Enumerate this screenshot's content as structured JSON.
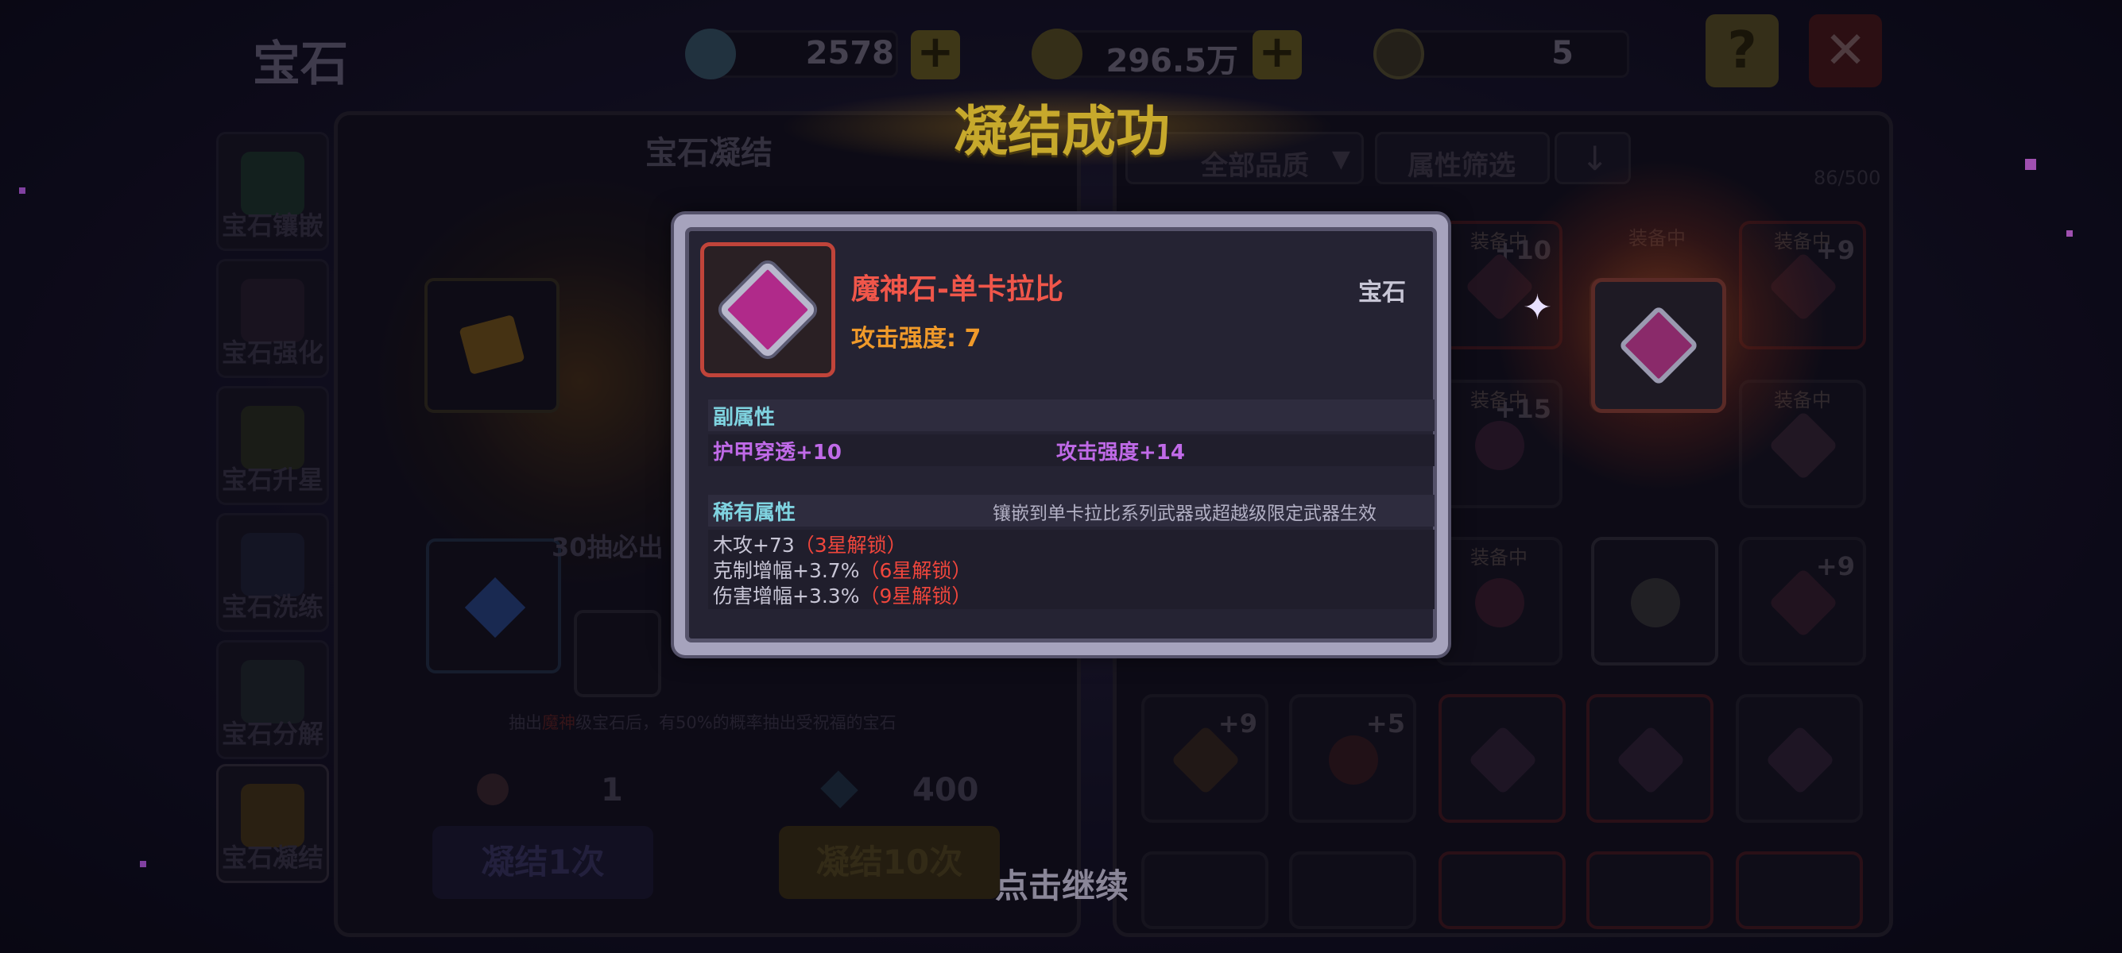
{
  "header": {
    "title": "宝石",
    "resources": [
      {
        "icon": "diamond-icon",
        "value": "2578"
      },
      {
        "icon": "gold-coin-icon",
        "value": "296.5万"
      },
      {
        "icon": "gem-token-icon",
        "value": "5"
      }
    ],
    "help_label": "?",
    "close_label": "✕"
  },
  "sidebar": {
    "items": [
      {
        "label": "宝石镶嵌",
        "icon": "gem-inlay-icon"
      },
      {
        "label": "宝石强化",
        "icon": "gem-enhance-icon"
      },
      {
        "label": "宝石升星",
        "icon": "gem-star-icon"
      },
      {
        "label": "宝石洗练",
        "icon": "gem-refine-icon"
      },
      {
        "label": "宝石分解",
        "icon": "gem-decompose-icon"
      },
      {
        "label": "宝石凝结",
        "icon": "gem-condense-icon"
      }
    ]
  },
  "condense_panel": {
    "title": "宝石凝结",
    "pity_text": "30抽必出",
    "hint_prefix": "抽出",
    "hint_highlight": "魔神",
    "hint_suffix": "级宝石后，有50%的概率抽出受祝福的宝石",
    "single": {
      "cost": "1",
      "button": "凝结1次"
    },
    "ten": {
      "cost": "400",
      "button": "凝结10次"
    }
  },
  "inventory_panel": {
    "quality_filter": "全部品质",
    "attr_filter": "属性筛选",
    "sort_icon": "arrow-down-icon",
    "count": "86/500",
    "equipped_tag": "装备中",
    "row1_pluses": [
      "+10",
      "",
      "+9"
    ],
    "row2_pluses": [
      "+15",
      "",
      ""
    ],
    "row3_pluses": [
      "",
      "",
      "+9"
    ],
    "row4_pluses": [
      "+9",
      "+5",
      "",
      "",
      ""
    ]
  },
  "banner": {
    "text": "凝结成功"
  },
  "popup": {
    "gem_name": "魔神石-单卡拉比",
    "category": "宝石",
    "attack_label": "攻击强度: 7",
    "sub_attr_title": "副属性",
    "sub_attrs": [
      "护甲穿透+10",
      "攻击强度+14"
    ],
    "rare_attr_title": "稀有属性",
    "rare_note": "镶嵌到单卡拉比系列武器或超越级限定武器生效",
    "rare_attrs": [
      {
        "text": "木攻+73",
        "lock": "（3星解锁）"
      },
      {
        "text": "克制增幅+3.7%",
        "lock": "（6星解锁）"
      },
      {
        "text": "伤害增幅+3.3%",
        "lock": "（9星解锁）"
      }
    ]
  },
  "continue_text": "点击继续",
  "colors": {
    "name_red": "#f0564a",
    "attack_orange": "#f09a2a",
    "title_cyan": "#7fd3e0",
    "sub_purple": "#c06ae8",
    "lock_red": "#f0463c",
    "banner_gold": "#c7a92c"
  }
}
